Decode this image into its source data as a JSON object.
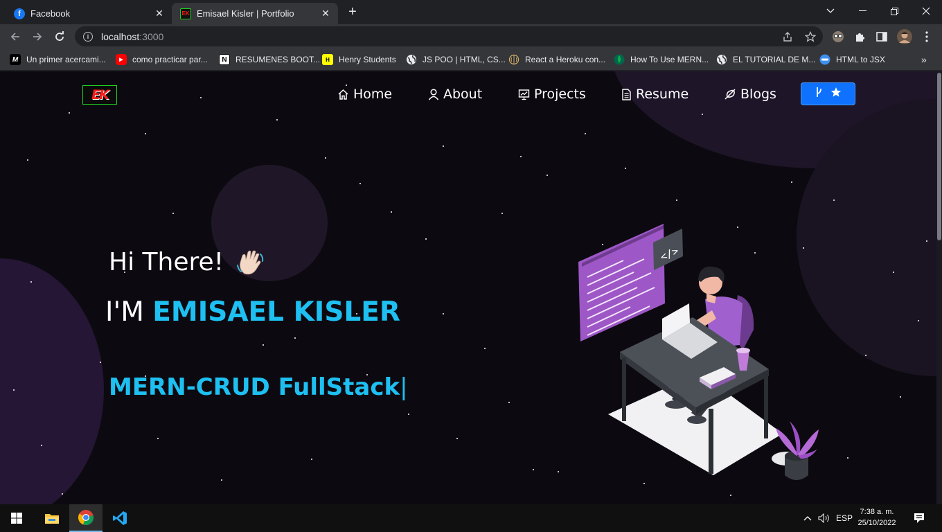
{
  "browser": {
    "tabs": [
      {
        "title": "Facebook",
        "active": false
      },
      {
        "title": "Emisael Kisler | Portfolio",
        "active": true
      }
    ],
    "url_host": "localhost",
    "url_port": ":3000",
    "bookmarks": [
      {
        "label": "Un primer acercami...",
        "icon": "medium-icon"
      },
      {
        "label": "como practicar par...",
        "icon": "youtube-icon"
      },
      {
        "label": "RESUMENES BOOT...",
        "icon": "notion-icon"
      },
      {
        "label": "Henry Students",
        "icon": "henry-icon"
      },
      {
        "label": "JS POO | HTML, CS...",
        "icon": "globe-icon"
      },
      {
        "label": "React a Heroku con...",
        "icon": "brain-icon"
      },
      {
        "label": "How To Use MERN...",
        "icon": "mongodb-icon"
      },
      {
        "label": "EL TUTORIAL DE M...",
        "icon": "globe-icon"
      },
      {
        "label": "HTML to JSX",
        "icon": "transform-icon"
      }
    ]
  },
  "site": {
    "logo_text": "EK",
    "nav": {
      "home": "Home",
      "about": "About",
      "projects": "Projects",
      "resume": "Resume",
      "blogs": "Blogs"
    },
    "hero": {
      "greeting": "Hi There!",
      "intro": "I'M",
      "name": "EMISAEL KISLER",
      "typed": "MERN-CRUD FullStack",
      "cursor": "|"
    },
    "colors": {
      "accent": "#1ec0f2",
      "button": "#0f72ff",
      "background": "#0c0a10"
    }
  },
  "taskbar": {
    "language": "ESP",
    "time": "7:38 a. m.",
    "date": "25/10/2022"
  }
}
